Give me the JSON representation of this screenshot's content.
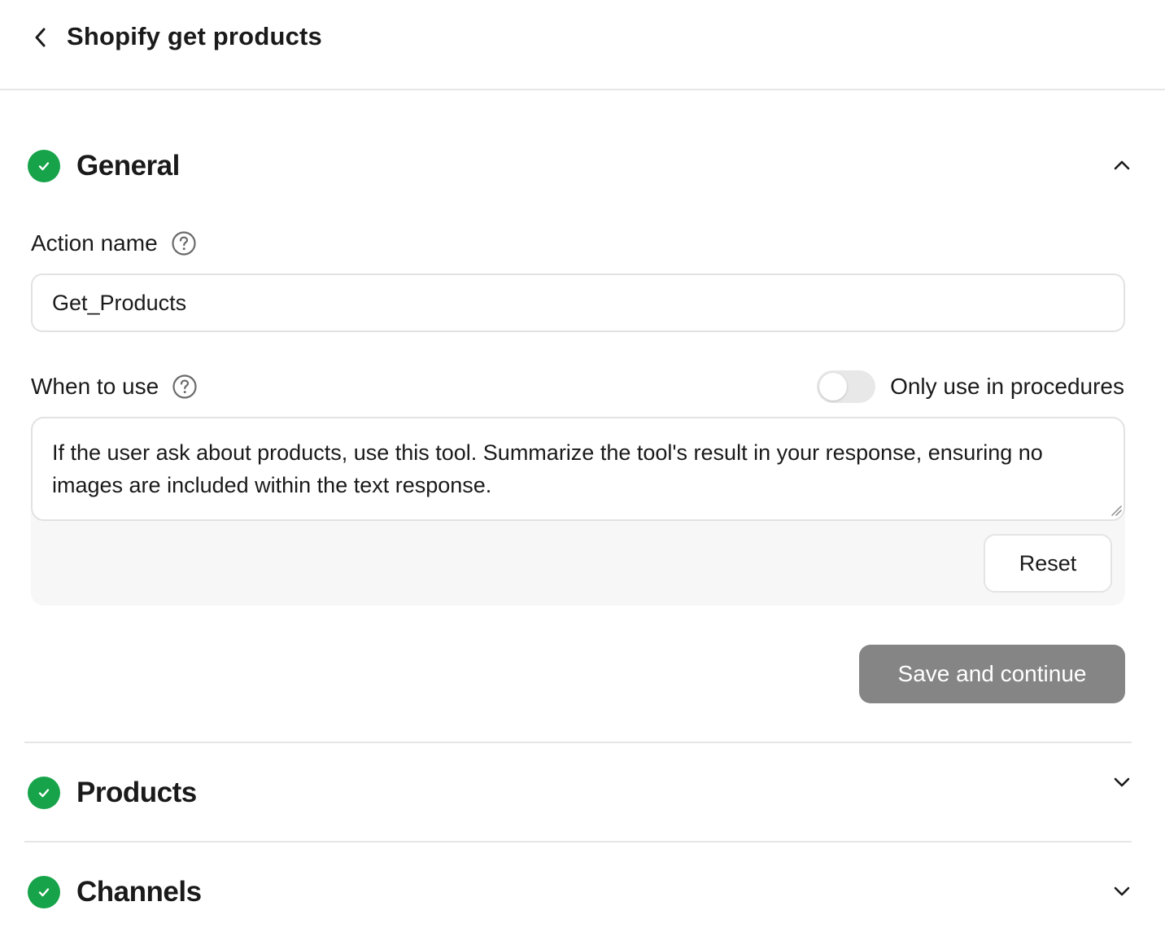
{
  "header": {
    "back_icon": "chevron-left-icon",
    "title": "Shopify get products"
  },
  "general": {
    "title": "General",
    "status_icon": "check-circle-icon",
    "status_color": "#17a34a",
    "expanded": true,
    "action_name": {
      "label": "Action name",
      "value": "Get_Products"
    },
    "when_to_use": {
      "label": "When to use",
      "value": "If the user ask about products, use this tool. Summarize the tool's result in your response, ensuring no images are included within the text response."
    },
    "only_procedures": {
      "label": "Only use in procedures",
      "enabled": false
    },
    "reset_label": "Reset",
    "save_label": "Save and continue"
  },
  "sections": [
    {
      "title": "Products",
      "expanded": false
    },
    {
      "title": "Channels",
      "expanded": false
    }
  ]
}
